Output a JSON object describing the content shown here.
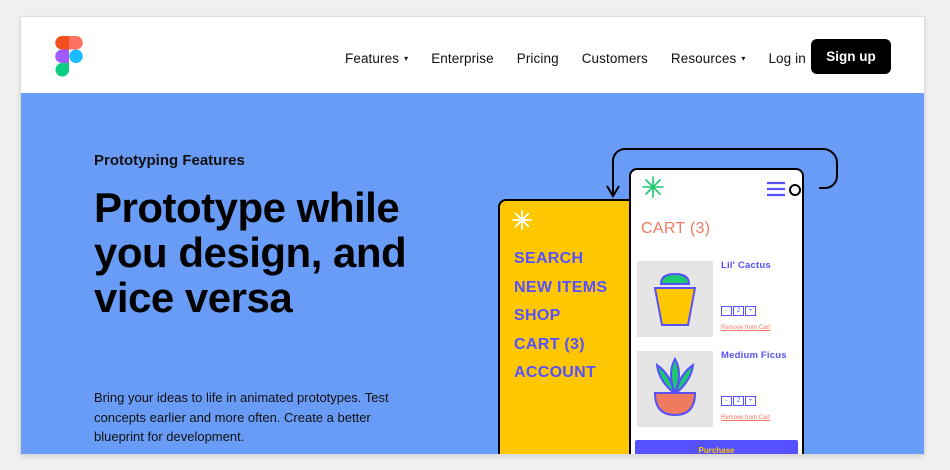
{
  "nav": {
    "items": [
      {
        "label": "Features",
        "has_dropdown": true
      },
      {
        "label": "Enterprise",
        "has_dropdown": false
      },
      {
        "label": "Pricing",
        "has_dropdown": false
      },
      {
        "label": "Customers",
        "has_dropdown": false
      },
      {
        "label": "Resources",
        "has_dropdown": true
      },
      {
        "label": "Log in",
        "has_dropdown": false
      }
    ],
    "caret": "▾",
    "signup_label": "Sign up"
  },
  "hero": {
    "eyebrow": "Prototyping Features",
    "headline": "Prototype while you design, and vice versa",
    "description": "Bring your ideas to life in animated prototypes. Test concepts earlier and more often. Create a better blueprint for development."
  },
  "illustration": {
    "menu_items": [
      "SEARCH",
      "NEW ITEMS",
      "SHOP",
      "CART (3)",
      "ACCOUNT"
    ],
    "cart_title": "CART (3)",
    "products": [
      {
        "name": "Lil' Cactus",
        "qty": "2",
        "minus": "-",
        "plus": "+",
        "remove_label": "Remove from Cart"
      },
      {
        "name": "Medium Ficus",
        "qty": "2",
        "minus": "-",
        "plus": "+",
        "remove_label": "Remove from Cart"
      }
    ],
    "purchase_label": "Purchase"
  },
  "colors": {
    "hero_background": "#699cf7",
    "menu_panel": "#ffc700",
    "accent_purple": "#5551ff",
    "cart_coral": "#f07a60",
    "signup_background": "#000000"
  }
}
